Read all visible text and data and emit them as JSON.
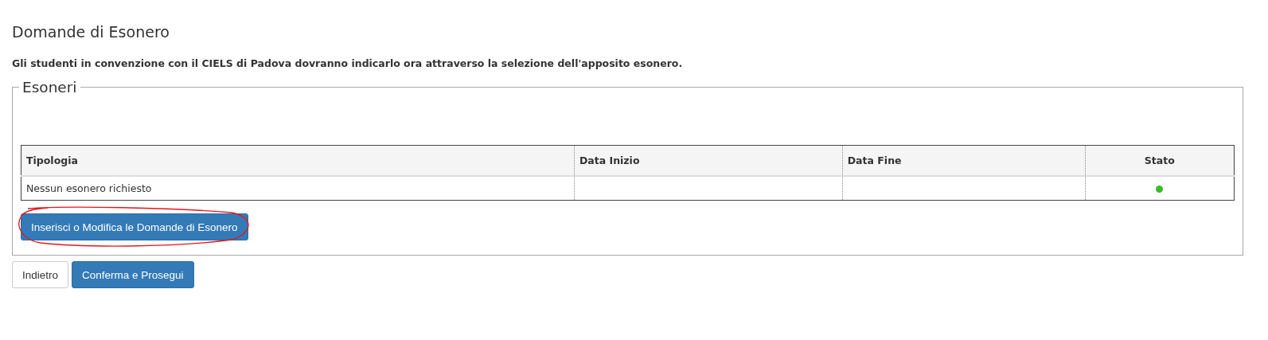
{
  "title": "Domande di Esonero",
  "notice": "Gli studenti in convenzione con il CIELS di Padova dovranno indicarlo ora attraverso la selezione dell'apposito esonero.",
  "fieldset": {
    "legend": "Esoneri",
    "table": {
      "columns": [
        "Tipologia",
        "Data Inizio",
        "Data Fine",
        "Stato"
      ],
      "rows": [
        {
          "tipologia": "Nessun esonero richiesto",
          "color": "#3dbb2f"
        }
      ]
    },
    "button": {
      "label": "Inserisci o Modifica le Domande di Esonero",
      "circled": true
    }
  },
  "buttons": [
    {
      "label": "Indietro",
      "kind": "default"
    },
    {
      "label": "Conferma e Prosegui",
      "kind": "primary"
    }
  ]
}
